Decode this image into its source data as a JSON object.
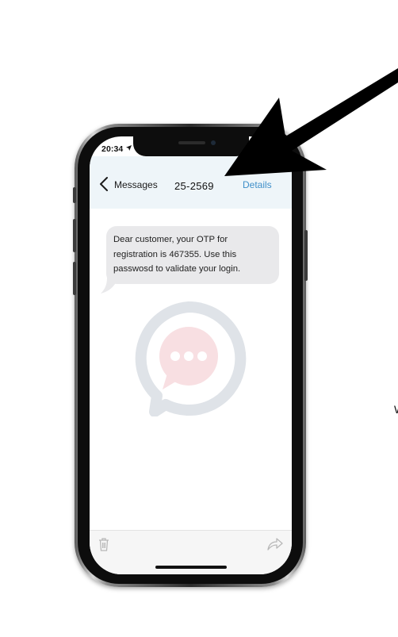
{
  "status_bar": {
    "time": "20:34",
    "location_icon": "location-arrow-icon"
  },
  "header": {
    "back_label": "Messages",
    "title": "25-2569",
    "details_label": "Details"
  },
  "message": {
    "text": "Dear customer, your OTP for registration is 467355. Use this passwosd to validate your login."
  },
  "watermark": {
    "icon": "chat-bubble-icon",
    "ring_color": "#dfe3e8",
    "fill_color": "#f8dfe2",
    "dot_color": "#ffffff"
  },
  "toolbar": {
    "left_icon": "trash-icon",
    "right_icon": "share-icon"
  },
  "edge_glyph": "W",
  "colors": {
    "header_bg": "#eef5f9",
    "details": "#3f8fc9",
    "bubble_bg": "#e9e9eb",
    "arrow": "#000000"
  }
}
